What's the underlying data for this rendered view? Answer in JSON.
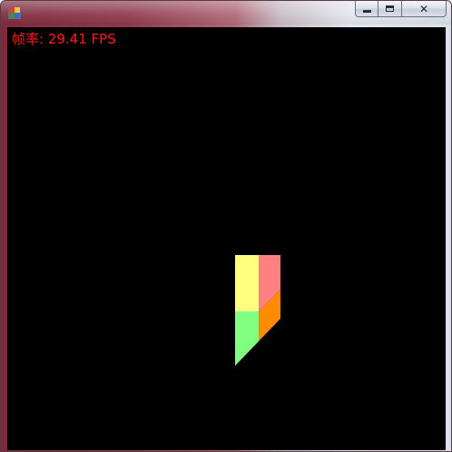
{
  "window": {
    "title": "",
    "app_icon": "form-icon",
    "controls": {
      "minimize_icon": "minimize-icon",
      "maximize_icon": "maximize-icon",
      "close_icon": "close-icon",
      "close_glyph": "✕"
    }
  },
  "overlay": {
    "fps_label": "帧率: 29.41 FPS",
    "fps_color": "#ff1a1a"
  },
  "scene": {
    "background": "#000000",
    "face_colors": {
      "top_left": "#ffff80",
      "top_right": "#ff8080",
      "bottom_left": "#80ff80",
      "bottom_right": "#ff8c00"
    }
  }
}
